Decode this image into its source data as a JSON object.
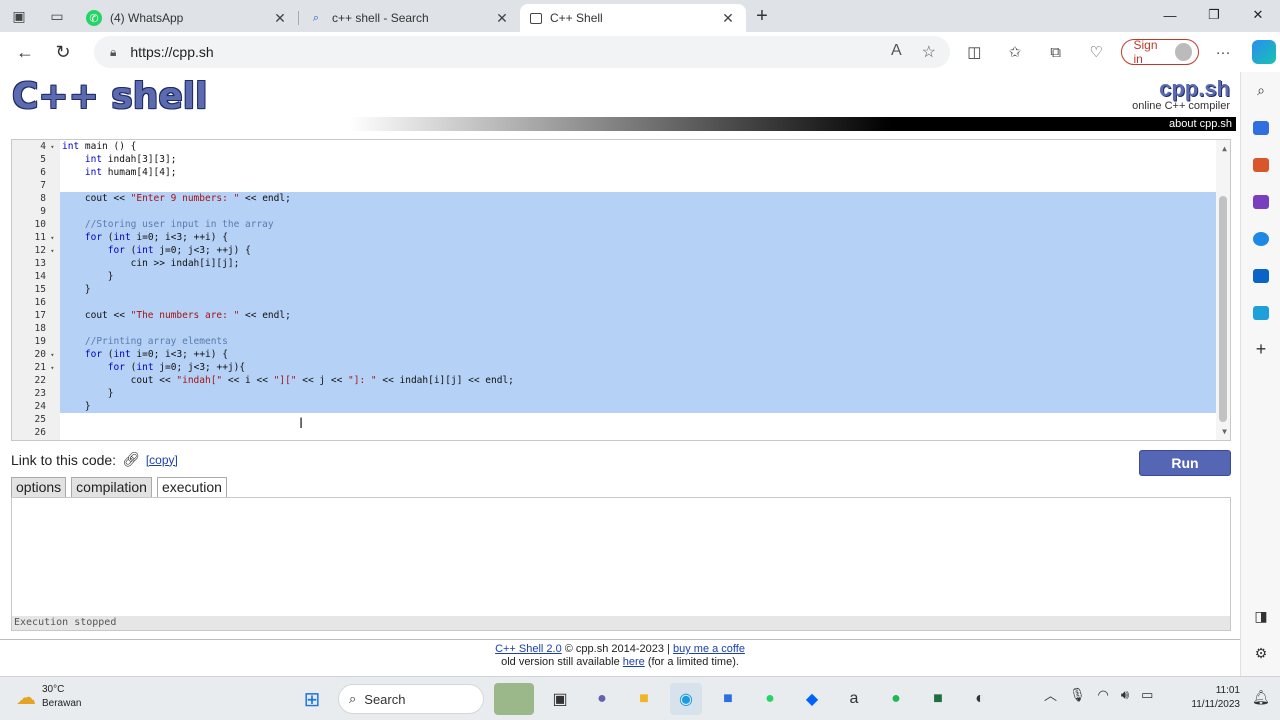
{
  "browser": {
    "tabs": [
      {
        "title": "(4) WhatsApp",
        "icon": "whatsapp-icon"
      },
      {
        "title": "c++ shell - Search",
        "icon": "search-icon"
      },
      {
        "title": "C++ Shell",
        "icon": "page-icon"
      }
    ],
    "url": "https://cpp.sh",
    "signin_label": "Sign in"
  },
  "site": {
    "logo": "C++ shell",
    "brand": "cpp.sh",
    "tagline": "online C++ compiler",
    "about": "about cpp.sh"
  },
  "editor": {
    "lines": [
      {
        "n": "4",
        "fold": true,
        "text": "int main () {"
      },
      {
        "n": "5",
        "fold": false,
        "text": "    int indah[3][3];"
      },
      {
        "n": "6",
        "fold": false,
        "text": "    int humam[4][4];"
      },
      {
        "n": "7",
        "fold": false,
        "text": ""
      },
      {
        "n": "8",
        "fold": false,
        "text": "    cout << \"Enter 9 numbers: \" << endl;"
      },
      {
        "n": "9",
        "fold": false,
        "text": ""
      },
      {
        "n": "10",
        "fold": false,
        "text": "    //Storing user input in the array"
      },
      {
        "n": "11",
        "fold": true,
        "text": "    for (int i=0; i<3; ++i) {"
      },
      {
        "n": "12",
        "fold": true,
        "text": "        for (int j=0; j<3; ++j) {"
      },
      {
        "n": "13",
        "fold": false,
        "text": "            cin >> indah[i][j];"
      },
      {
        "n": "14",
        "fold": false,
        "text": "        }"
      },
      {
        "n": "15",
        "fold": false,
        "text": "    }"
      },
      {
        "n": "16",
        "fold": false,
        "text": ""
      },
      {
        "n": "17",
        "fold": false,
        "text": "    cout << \"The numbers are: \" << endl;"
      },
      {
        "n": "18",
        "fold": false,
        "text": ""
      },
      {
        "n": "19",
        "fold": false,
        "text": "    //Printing array elements"
      },
      {
        "n": "20",
        "fold": true,
        "text": "    for (int i=0; i<3; ++i) {"
      },
      {
        "n": "21",
        "fold": true,
        "text": "        for (int j=0; j<3; ++j){"
      },
      {
        "n": "22",
        "fold": false,
        "text": "            cout << \"indah[\" << i << \"][\" << j << \"]: \" << indah[i][j] << endl;"
      },
      {
        "n": "23",
        "fold": false,
        "text": "        }"
      },
      {
        "n": "24",
        "fold": false,
        "text": "    }"
      },
      {
        "n": "25",
        "fold": false,
        "text": ""
      },
      {
        "n": "26",
        "fold": false,
        "text": ""
      }
    ],
    "selection": {
      "from_line": "8",
      "to_line": "24"
    }
  },
  "link_row": {
    "label": "Link to this code:",
    "copy": "[copy]"
  },
  "run_label": "Run",
  "panel_tabs": [
    "options",
    "compilation",
    "execution"
  ],
  "active_panel_tab": "execution",
  "status": "Execution stopped",
  "footer": {
    "shell_link": "C++ Shell 2.0",
    "copyright": " © cpp.sh 2014-2023 | ",
    "coffee_link": "buy me a coffe",
    "old_prefix": "old version still available ",
    "here_link": "here",
    "old_suffix": " (for a limited time)."
  },
  "taskbar": {
    "temperature": "30°C",
    "weather": "Berawan",
    "search_label": "Search",
    "time": "11:01",
    "date": "11/11/2023"
  },
  "colors": {
    "selection": "#b5d1f5",
    "run_button": "#5566b4",
    "logo": "#5c6bb0"
  }
}
